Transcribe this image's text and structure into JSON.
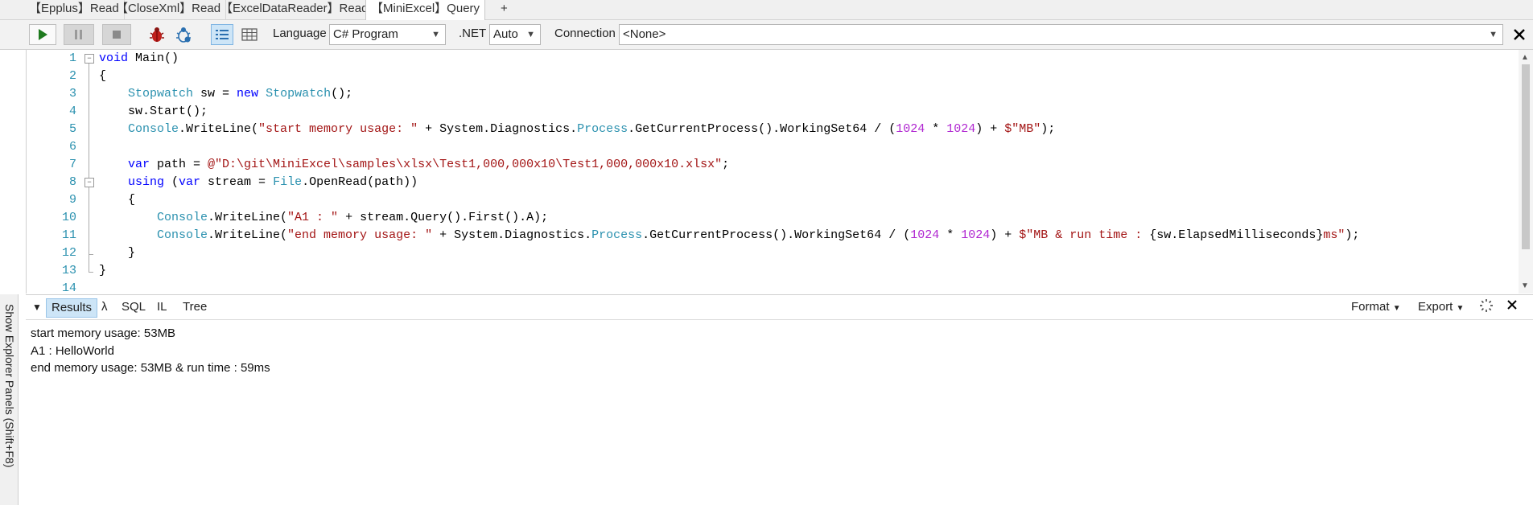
{
  "tabs": [
    {
      "label": "【Epplus】Read"
    },
    {
      "label": "【CloseXml】Read"
    },
    {
      "label": "【ExcelDataReader】Read"
    },
    {
      "label": "【MiniExcel】Query"
    },
    {
      "label": "+"
    }
  ],
  "toolbar": {
    "language_label": "Language",
    "language_value": "C# Program",
    "dotnet_label": ".NET",
    "dotnet_value": "Auto",
    "connection_label": "Connection",
    "connection_value": "<None>"
  },
  "editor": {
    "line_numbers": [
      "1",
      "2",
      "3",
      "4",
      "5",
      "6",
      "7",
      "8",
      "9",
      "10",
      "11",
      "12",
      "13",
      "14"
    ]
  },
  "code": {
    "l1_kw": "void",
    "l1_rest": " Main()",
    "l2": "{",
    "l3_ty1": "Stopwatch",
    "l3_mid": " sw = ",
    "l3_kw": "new",
    "l3_sp": " ",
    "l3_ty2": "Stopwatch",
    "l3_end": "();",
    "l4": "sw.Start();",
    "l5_ty1": "Console",
    "l5_a": ".WriteLine(",
    "l5_s1": "\"start memory usage: \"",
    "l5_b": " + System.Diagnostics.",
    "l5_ty2": "Process",
    "l5_c": ".GetCurrentProcess().WorkingSet64 / (",
    "l5_n1": "1024",
    "l5_d": " * ",
    "l5_n2": "1024",
    "l5_e": ") + ",
    "l5_s2": "$\"MB\"",
    "l5_f": ");",
    "l7_kw": "var",
    "l7_a": " path = ",
    "l7_s": "@\"D:\\git\\MiniExcel\\samples\\xlsx\\Test1,000,000x10\\Test1,000,000x10.xlsx\"",
    "l7_b": ";",
    "l8_kw1": "using",
    "l8_a": " (",
    "l8_kw2": "var",
    "l8_b": " stream = ",
    "l8_ty": "File",
    "l8_c": ".OpenRead(path))",
    "l9": "{",
    "l10_ty": "Console",
    "l10_a": ".WriteLine(",
    "l10_s": "\"A1 : \"",
    "l10_b": " + stream.Query().First().A);",
    "l11_ty1": "Console",
    "l11_a": ".WriteLine(",
    "l11_s1": "\"end memory usage: \"",
    "l11_b": " + System.Diagnostics.",
    "l11_ty2": "Process",
    "l11_c": ".GetCurrentProcess().WorkingSet64 / (",
    "l11_n1": "1024",
    "l11_d": " * ",
    "l11_n2": "1024",
    "l11_e": ") + ",
    "l11_s2": "$\"MB & run time : ",
    "l11_f": "{sw.ElapsedMilliseconds}",
    "l11_s3": "ms\"",
    "l11_g": ");",
    "l12": "}",
    "l13": "}"
  },
  "results_bar": {
    "results": "Results",
    "lambda": "λ",
    "sql": "SQL",
    "il": "IL",
    "tree": "Tree",
    "format": "Format",
    "export": "Export"
  },
  "output": {
    "line1": "start memory usage: 53MB",
    "line2": "A1 : HelloWorld",
    "line3": "end memory usage: 53MB & run time : 59ms"
  },
  "side_panel": {
    "label": "Show Explorer Panels  (Shift+F8)"
  },
  "colors": {
    "keyword": "#0000ff",
    "type": "#2b91af",
    "string": "#a31515",
    "number": "#b026d1",
    "line_number": "#2b91af"
  }
}
